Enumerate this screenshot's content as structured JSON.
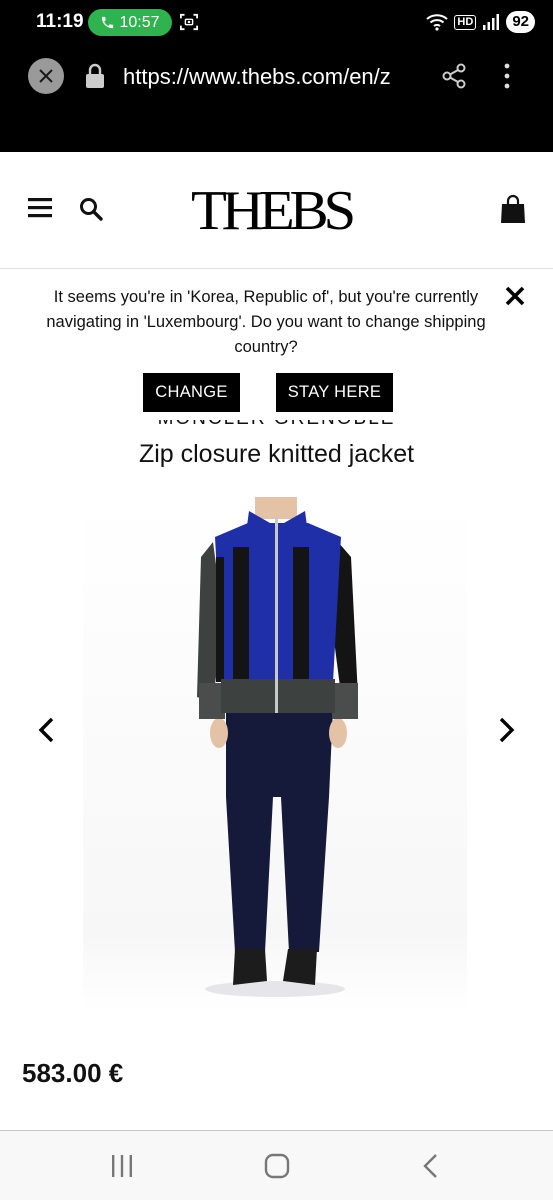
{
  "status_bar": {
    "time": "11:19",
    "call_duration": "10:57",
    "hd_label": "HD",
    "battery": "92"
  },
  "browser": {
    "url": "https://www.thebs.com/en/z"
  },
  "header": {
    "logo": "THEBS"
  },
  "banner": {
    "message": "It seems you're in 'Korea, Republic of', but you're currently navigating in 'Luxembourg'. Do you want to change shipping country?",
    "change_label": "CHANGE",
    "stay_label": "STAY HERE"
  },
  "product": {
    "brand": "MONCLER GRENOBLE",
    "title": "Zip closure knitted jacket",
    "price": "583.00 €"
  },
  "colors": {
    "jacket_blue": "#1f2fa8",
    "jacket_black": "#141414",
    "jacket_grey": "#3d4240",
    "trousers": "#151a3a",
    "call_green": "#2fb34f"
  }
}
